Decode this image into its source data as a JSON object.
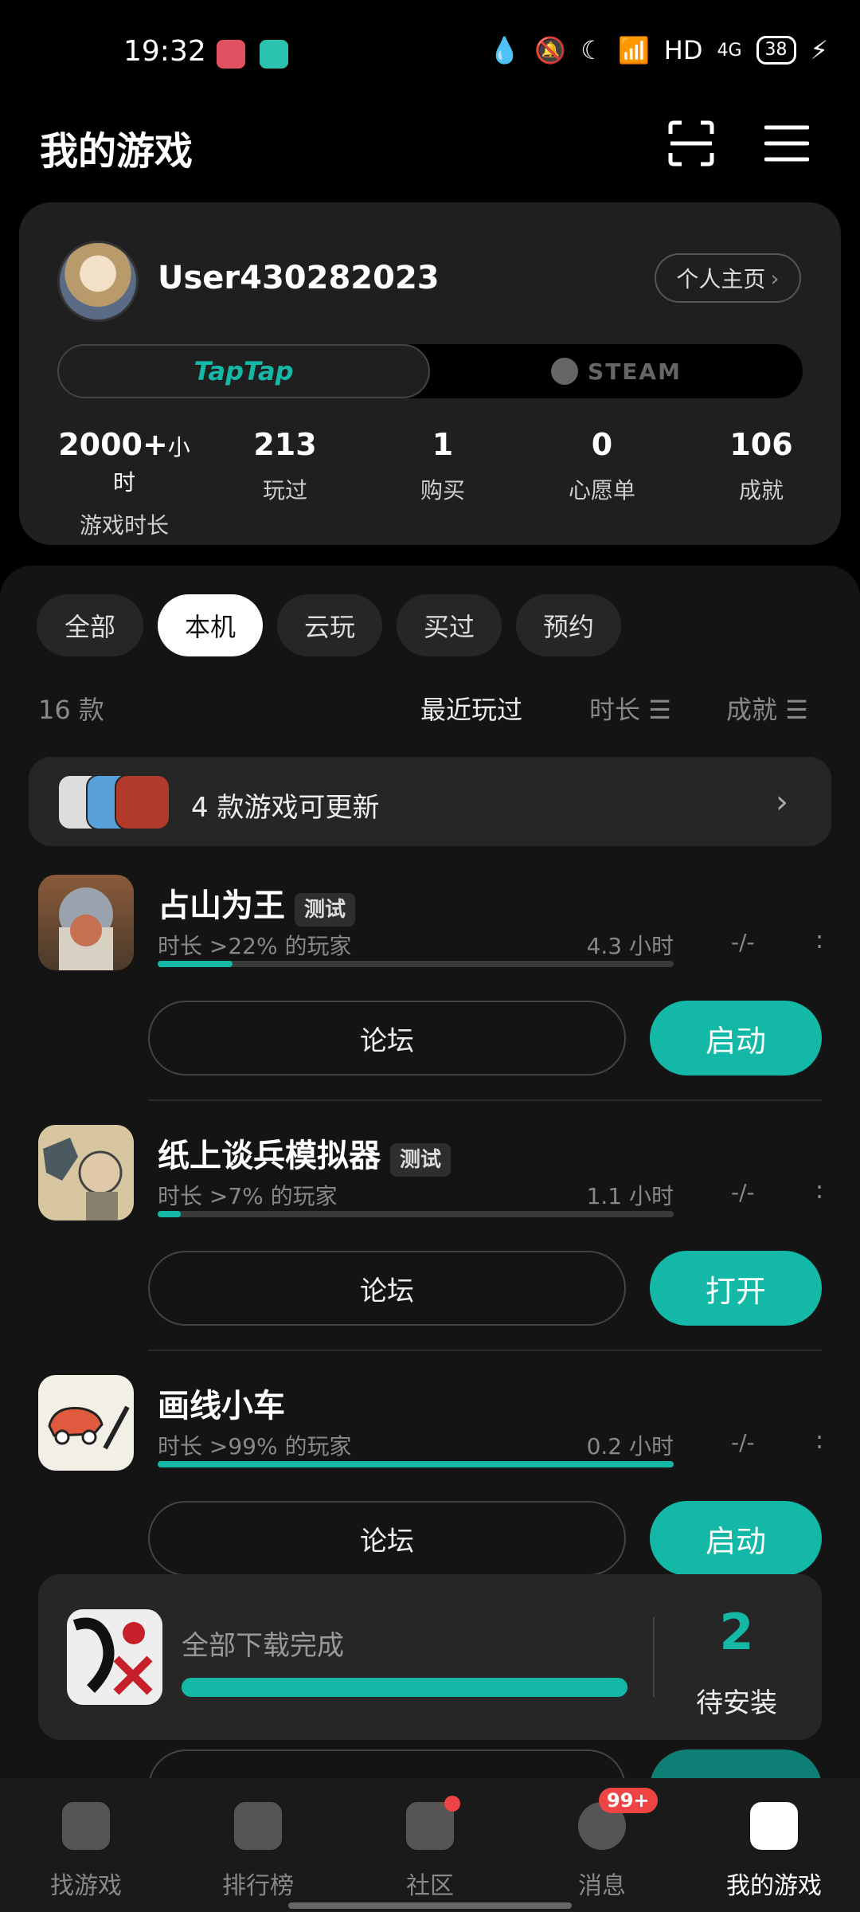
{
  "status": {
    "time": "19:32",
    "network": "HD",
    "signal": "4G",
    "battery": "38"
  },
  "header": {
    "title": "我的游戏"
  },
  "profile": {
    "username": "User430282023",
    "homepage_label": "个人主页",
    "platforms": [
      "TapTap",
      "STEAM"
    ],
    "stats": [
      {
        "value": "2000+",
        "unit": "小时",
        "label": "游戏时长"
      },
      {
        "value": "213",
        "unit": "",
        "label": "玩过"
      },
      {
        "value": "1",
        "unit": "",
        "label": "购买"
      },
      {
        "value": "0",
        "unit": "",
        "label": "心愿单"
      },
      {
        "value": "106",
        "unit": "",
        "label": "成就"
      }
    ]
  },
  "filters": {
    "chips": [
      "全部",
      "本机",
      "云玩",
      "买过",
      "预约"
    ],
    "active": "本机"
  },
  "list": {
    "count": "16 款",
    "sort": [
      "最近玩过",
      "时长",
      "成就"
    ]
  },
  "update": {
    "text": "4 款游戏可更新"
  },
  "games": [
    {
      "title": "占山为王",
      "tag": "测试",
      "percentile": "时长 >22% 的玩家",
      "hours": "4.3 小时",
      "achievement": "-/-",
      "progress": 0.145,
      "forum": "论坛",
      "action": "启动"
    },
    {
      "title": "纸上谈兵模拟器",
      "tag": "测试",
      "percentile": "时长 >7% 的玩家",
      "hours": "1.1 小时",
      "achievement": "-/-",
      "progress": 0.045,
      "forum": "论坛",
      "action": "打开"
    },
    {
      "title": "画线小车",
      "tag": "",
      "percentile": "时长 >99% 的玩家",
      "hours": "0.2 小时",
      "achievement": "-/-",
      "progress": 1.0,
      "forum": "论坛",
      "action": "启动"
    }
  ],
  "download": {
    "text": "全部下载完成",
    "pending_count": "2",
    "pending_label": "待安装",
    "progress": 1.0
  },
  "nav": [
    {
      "label": "找游戏",
      "icon": "taptap-icon"
    },
    {
      "label": "排行榜",
      "icon": "ranking-icon"
    },
    {
      "label": "社区",
      "icon": "community-icon"
    },
    {
      "label": "消息",
      "icon": "message-icon",
      "badge": "99+"
    },
    {
      "label": "我的游戏",
      "icon": "gamepad-icon",
      "active": true
    }
  ],
  "colors": {
    "accent": "#14b8a6",
    "background": "#000000",
    "card": "#1f1f1f"
  }
}
